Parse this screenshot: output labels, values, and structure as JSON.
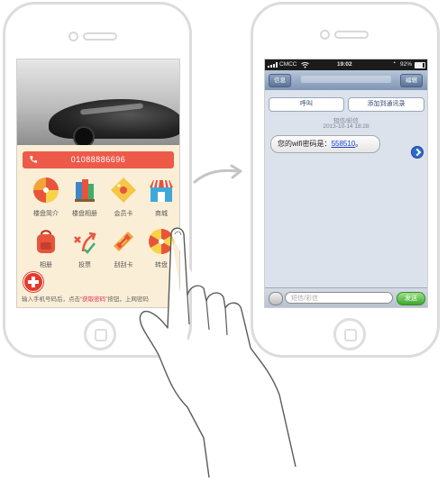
{
  "left_app": {
    "phone_number": "01088886696",
    "tiles": [
      {
        "label": "楼盘简介",
        "icon": "candy-swirl-icon"
      },
      {
        "label": "楼盘相册",
        "icon": "books-icon"
      },
      {
        "label": "会员卡",
        "icon": "diamond-tag-icon"
      },
      {
        "label": "商城",
        "icon": "shop-icon"
      },
      {
        "label": "相册",
        "icon": "backpack-icon"
      },
      {
        "label": "投票",
        "icon": "vote-arrows-icon"
      },
      {
        "label": "刮刮卡",
        "icon": "hotdog-icon"
      },
      {
        "label": "转盘",
        "icon": "wheel-icon"
      }
    ],
    "hint_prefix": "输入手机号码后，点击“",
    "hint_highlight": "获取密码",
    "hint_suffix": "”按钮，上网密码"
  },
  "sms": {
    "carrier": "CMCC",
    "time": "19:02",
    "battery": "92%",
    "back_label": "信息",
    "edit_label": "编辑",
    "call_label": "呼叫",
    "add_contact_label": "添加到通讯录",
    "message_type": "短信/彩信",
    "timestamp": "2013-10-14 18:28",
    "message_prefix": "您的wifi密码是：",
    "message_code": "558510",
    "message_suffix": "。",
    "input_placeholder": "短信/彩信",
    "send_label": "发送"
  },
  "colors": {
    "call_bar": "#ed5a4a",
    "app_background": "#fbeed6",
    "link": "#1a3fd0",
    "send": "#3ea72a"
  }
}
